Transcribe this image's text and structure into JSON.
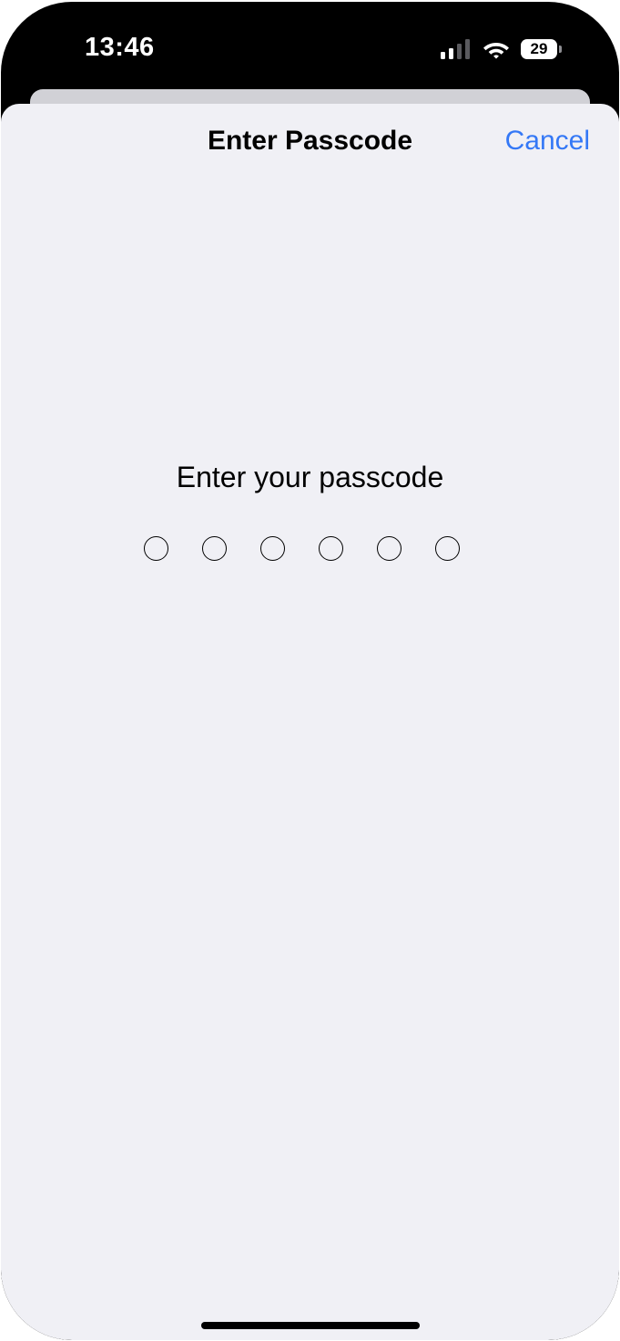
{
  "status_bar": {
    "time": "13:46",
    "battery_level": "29",
    "icons": [
      "signal-icon",
      "wifi-icon",
      "battery-icon"
    ]
  },
  "sheet": {
    "title": "Enter Passcode",
    "cancel_label": "Cancel",
    "prompt": "Enter your passcode",
    "passcode_length": 6,
    "digits_entered": 0
  },
  "colors": {
    "accent": "#3478f6",
    "sheet_background": "#f0f0f5",
    "device_background": "#000000"
  }
}
